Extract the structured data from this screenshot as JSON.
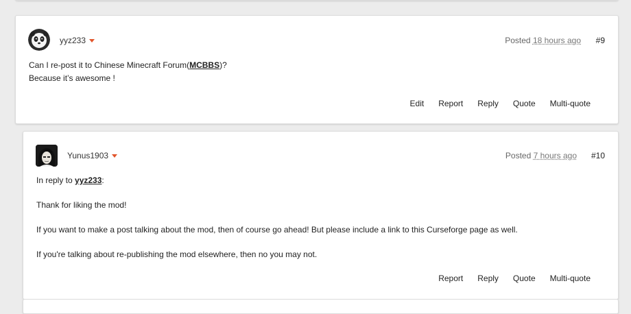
{
  "post9": {
    "author": "yyz233",
    "posted_label": "Posted",
    "posted_time": "18 hours ago",
    "number": "#9",
    "line1_before": "Can I re-post it to Chinese Minecraft Forum(",
    "line1_link": "MCBBS",
    "line1_after": ")?",
    "line2": "Because it’s awesome !",
    "actions": [
      "Edit",
      "Report",
      "Reply",
      "Quote",
      "Multi-quote"
    ]
  },
  "post10": {
    "author": "Yunus1903",
    "posted_label": "Posted",
    "posted_time": "7 hours ago",
    "number": "#10",
    "reply_prefix": "In reply to ",
    "reply_user": "yyz233",
    "reply_suffix": ":",
    "para1": "Thank for liking the mod!",
    "para2": "If you want to make a post talking about the mod, then of course go ahead! But please include a link to this Curseforge page as well.",
    "para3": "If you're talking about re-publishing the mod elsewhere, then no you may not.",
    "actions": [
      "Report",
      "Reply",
      "Quote",
      "Multi-quote"
    ]
  },
  "colors": {
    "accent": "#e2552b",
    "background": "#ececec",
    "card": "#ffffff"
  },
  "icons": {
    "author_menu": "caret-down-icon"
  }
}
